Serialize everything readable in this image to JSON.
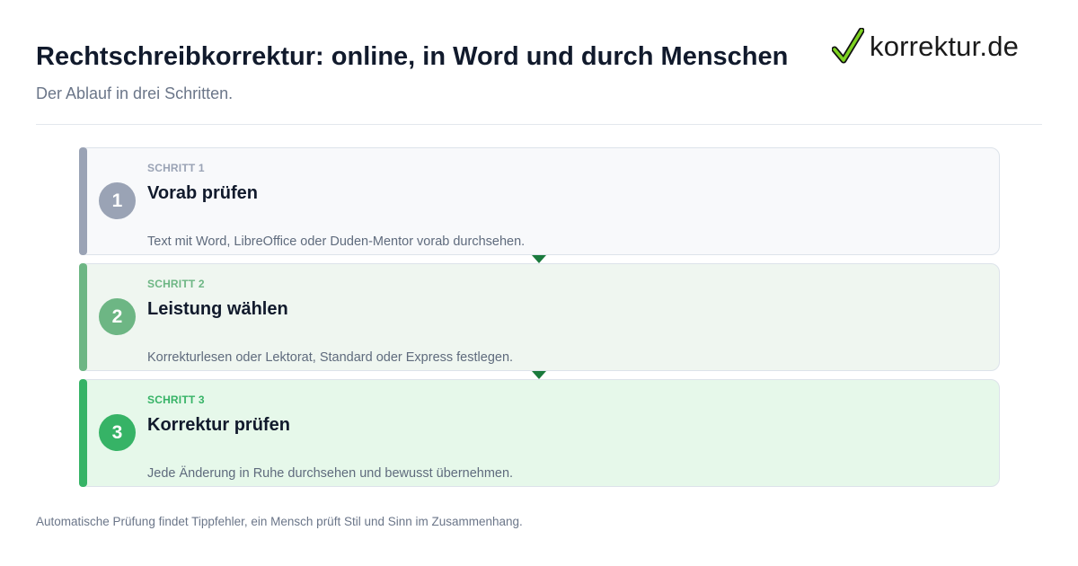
{
  "header": {
    "title": "Rechtschreibkorrektur: online, in Word und durch Menschen",
    "subtitle": "Der Ablauf in drei Schritten."
  },
  "logo": {
    "text": "korrektur.de",
    "icon": "checkmark-icon",
    "check_color": "#7ed321"
  },
  "steps": [
    {
      "number": "1",
      "kicker": "SCHRITT 1",
      "title": "Vorab prüfen",
      "description": "Text mit Word, LibreOffice oder Duden-Mentor vorab durchsehen.",
      "accent": "#9aa3b5",
      "background": "#f8f9fb"
    },
    {
      "number": "2",
      "kicker": "SCHRITT 2",
      "title": "Leistung wählen",
      "description": "Korrekturlesen oder Lektorat, Standard oder Express festlegen.",
      "accent": "#6db684",
      "background": "#eff6f0"
    },
    {
      "number": "3",
      "kicker": "SCHRITT 3",
      "title": "Korrektur prüfen",
      "description": "Jede Änderung in Ruhe durchsehen und bewusst übernehmen.",
      "accent": "#36b366",
      "background": "#e6f8ea"
    }
  ],
  "connector_color": "#1a7a3d",
  "footnote": "Automatische Prüfung findet Tippfehler, ein Mensch prüft Stil und Sinn im Zusammenhang."
}
